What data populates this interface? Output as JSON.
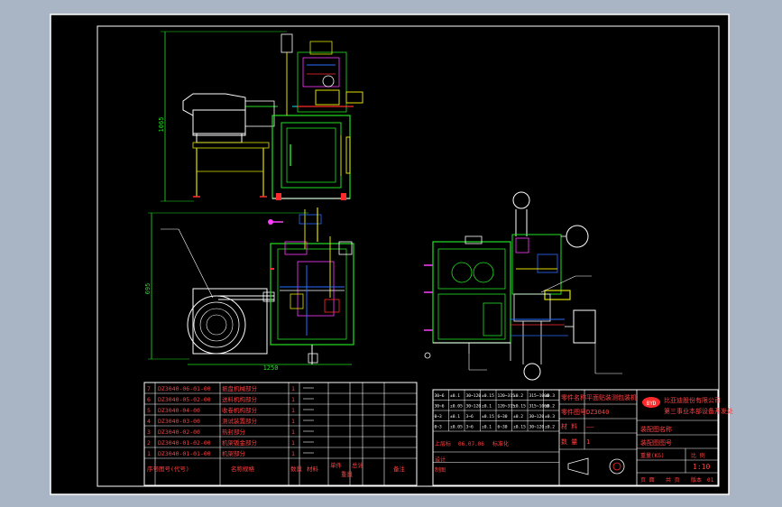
{
  "colors": {
    "backdrop": "#a9b4c4",
    "paper": "#000000",
    "frame": "#ffffff",
    "machine": "#22e022",
    "parts": "#e0e000",
    "accent": "#ff2a2a",
    "wire": "#2a6cff",
    "pink": "#ff3cff",
    "cyan": "#18e6e6",
    "title_red": "#ff4040",
    "table_text": "#ff4040"
  },
  "drawing": {
    "height_dim": "1065",
    "depth_dim": "695",
    "width_dim": "1250"
  },
  "parts_list": {
    "rows": [
      {
        "no": "7",
        "code": "DZ3040-06-01-00",
        "name": "振盘机械部分",
        "qty": "1"
      },
      {
        "no": "6",
        "code": "DZ3040-05-02-00",
        "name": "送料机构部分",
        "qty": "1"
      },
      {
        "no": "5",
        "code": "DZ3040-04-00",
        "name": "收卷机构部分",
        "qty": "1"
      },
      {
        "no": "4",
        "code": "DZ3040-03-00",
        "name": "测试装置部分",
        "qty": "1"
      },
      {
        "no": "3",
        "code": "DZ3040-02-00",
        "name": "热封部分",
        "qty": "1"
      },
      {
        "no": "2",
        "code": "DZ3040-01-02-00",
        "name": "机架钣金部分",
        "qty": "1"
      },
      {
        "no": "1",
        "code": "DZ3040-01-01-00",
        "name": "机架部分",
        "qty": "1"
      }
    ],
    "header": {
      "no": "序号",
      "code": "图号(代号)",
      "name": "名称规格",
      "qty": "数量",
      "material": "材料",
      "unit_weight": "单件",
      "total_weight": "总计",
      "weight": "重量",
      "note": "备注"
    }
  },
  "title_block": {
    "part_name_label": "零件名称",
    "part_name": "平面贴装测包装机",
    "drawing_no_label": "零件图号",
    "drawing_no": "DZ3040",
    "material_label": "材 料",
    "material": "——",
    "quantity_label": "数 量",
    "quantity": "1",
    "company": "比亚迪股份有限公司",
    "department": "第三事业本部设备开发处",
    "assembly_label": "装配图名称",
    "assembly_no_label": "装配图图号",
    "scale_label": "比 例",
    "scale": "1:10",
    "weight_label": "重量(KG)",
    "sheet_label": "页 面",
    "total_label": "共 页",
    "version_label": "版本",
    "version": "01",
    "designer_row": "上层标",
    "date": "06.07.06",
    "review": "标准化"
  },
  "revision_table": {
    "rows": [
      [
        "30~6",
        "±0.1",
        "30~120",
        "±0.15",
        "120~315",
        "±0.2",
        "315~1000",
        "±0.3"
      ],
      [
        "30~6",
        "±0.05",
        "30~120",
        "±0.1",
        "120~315",
        "±0.15",
        "315~1000",
        "±0.2"
      ],
      [
        "0~3",
        "±0.1",
        "3~6",
        "±0.15",
        "6~30",
        "±0.2",
        "30~120",
        "±0.3"
      ],
      [
        "0~3",
        "±0.05",
        "3~6",
        "±0.1",
        "6~30",
        "±0.15",
        "30~120",
        "±0.2"
      ],
      [
        "设计",
        "",
        "",
        "",
        "",
        "",
        "",
        ""
      ],
      [
        "制图",
        "",
        "",
        "",
        "",
        "",
        "",
        ""
      ]
    ]
  }
}
